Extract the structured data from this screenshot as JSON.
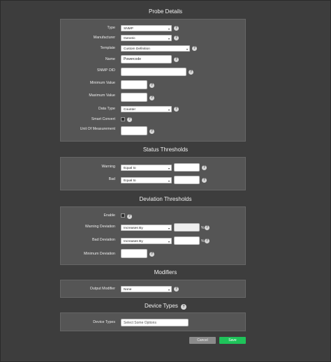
{
  "sections": {
    "probe_details": "Probe Details",
    "status_thresholds": "Status Thresholds",
    "deviation_thresholds": "Deviation Thresholds",
    "modifiers": "Modifiers",
    "device_types": "Device Types"
  },
  "probe": {
    "type_label": "Type",
    "type_value": "SNMP",
    "manufacturer_label": "Manufacturer",
    "manufacturer_value": "Generic",
    "template_label": "Template",
    "template_value": "Custom Definition",
    "name_label": "Name",
    "name_value": "Powercode",
    "snmp_oid_label": "SNMP OID",
    "snmp_oid_value": "",
    "min_label": "Minimum Value",
    "min_value": "",
    "max_label": "Maximum Value",
    "max_value": "",
    "data_type_label": "Data Type",
    "data_type_value": "Counter",
    "smart_convert_label": "Smart Convert",
    "unit_label": "Unit Of Measurement",
    "unit_value": ""
  },
  "status": {
    "warning_label": "Warning",
    "warning_op": "Equal to",
    "warning_value": "",
    "bad_label": "Bad",
    "bad_op": "Equal to",
    "bad_value": ""
  },
  "deviation": {
    "enable_label": "Enable",
    "warning_label": "Warning Deviation",
    "warning_op": "Increases By",
    "warning_value": "",
    "bad_label": "Bad Deviation",
    "bad_op": "Increases By",
    "bad_value": "",
    "pct_symbol": "%",
    "min_label": "Minimum Deviation",
    "min_value": ""
  },
  "modifiers": {
    "output_label": "Output Modifier",
    "output_value": "None"
  },
  "device_types": {
    "label": "Device Types",
    "placeholder": "Select Some Options"
  },
  "buttons": {
    "cancel": "Cancel",
    "save": "Save"
  },
  "help_glyph": "?",
  "caret_glyph": "▾"
}
